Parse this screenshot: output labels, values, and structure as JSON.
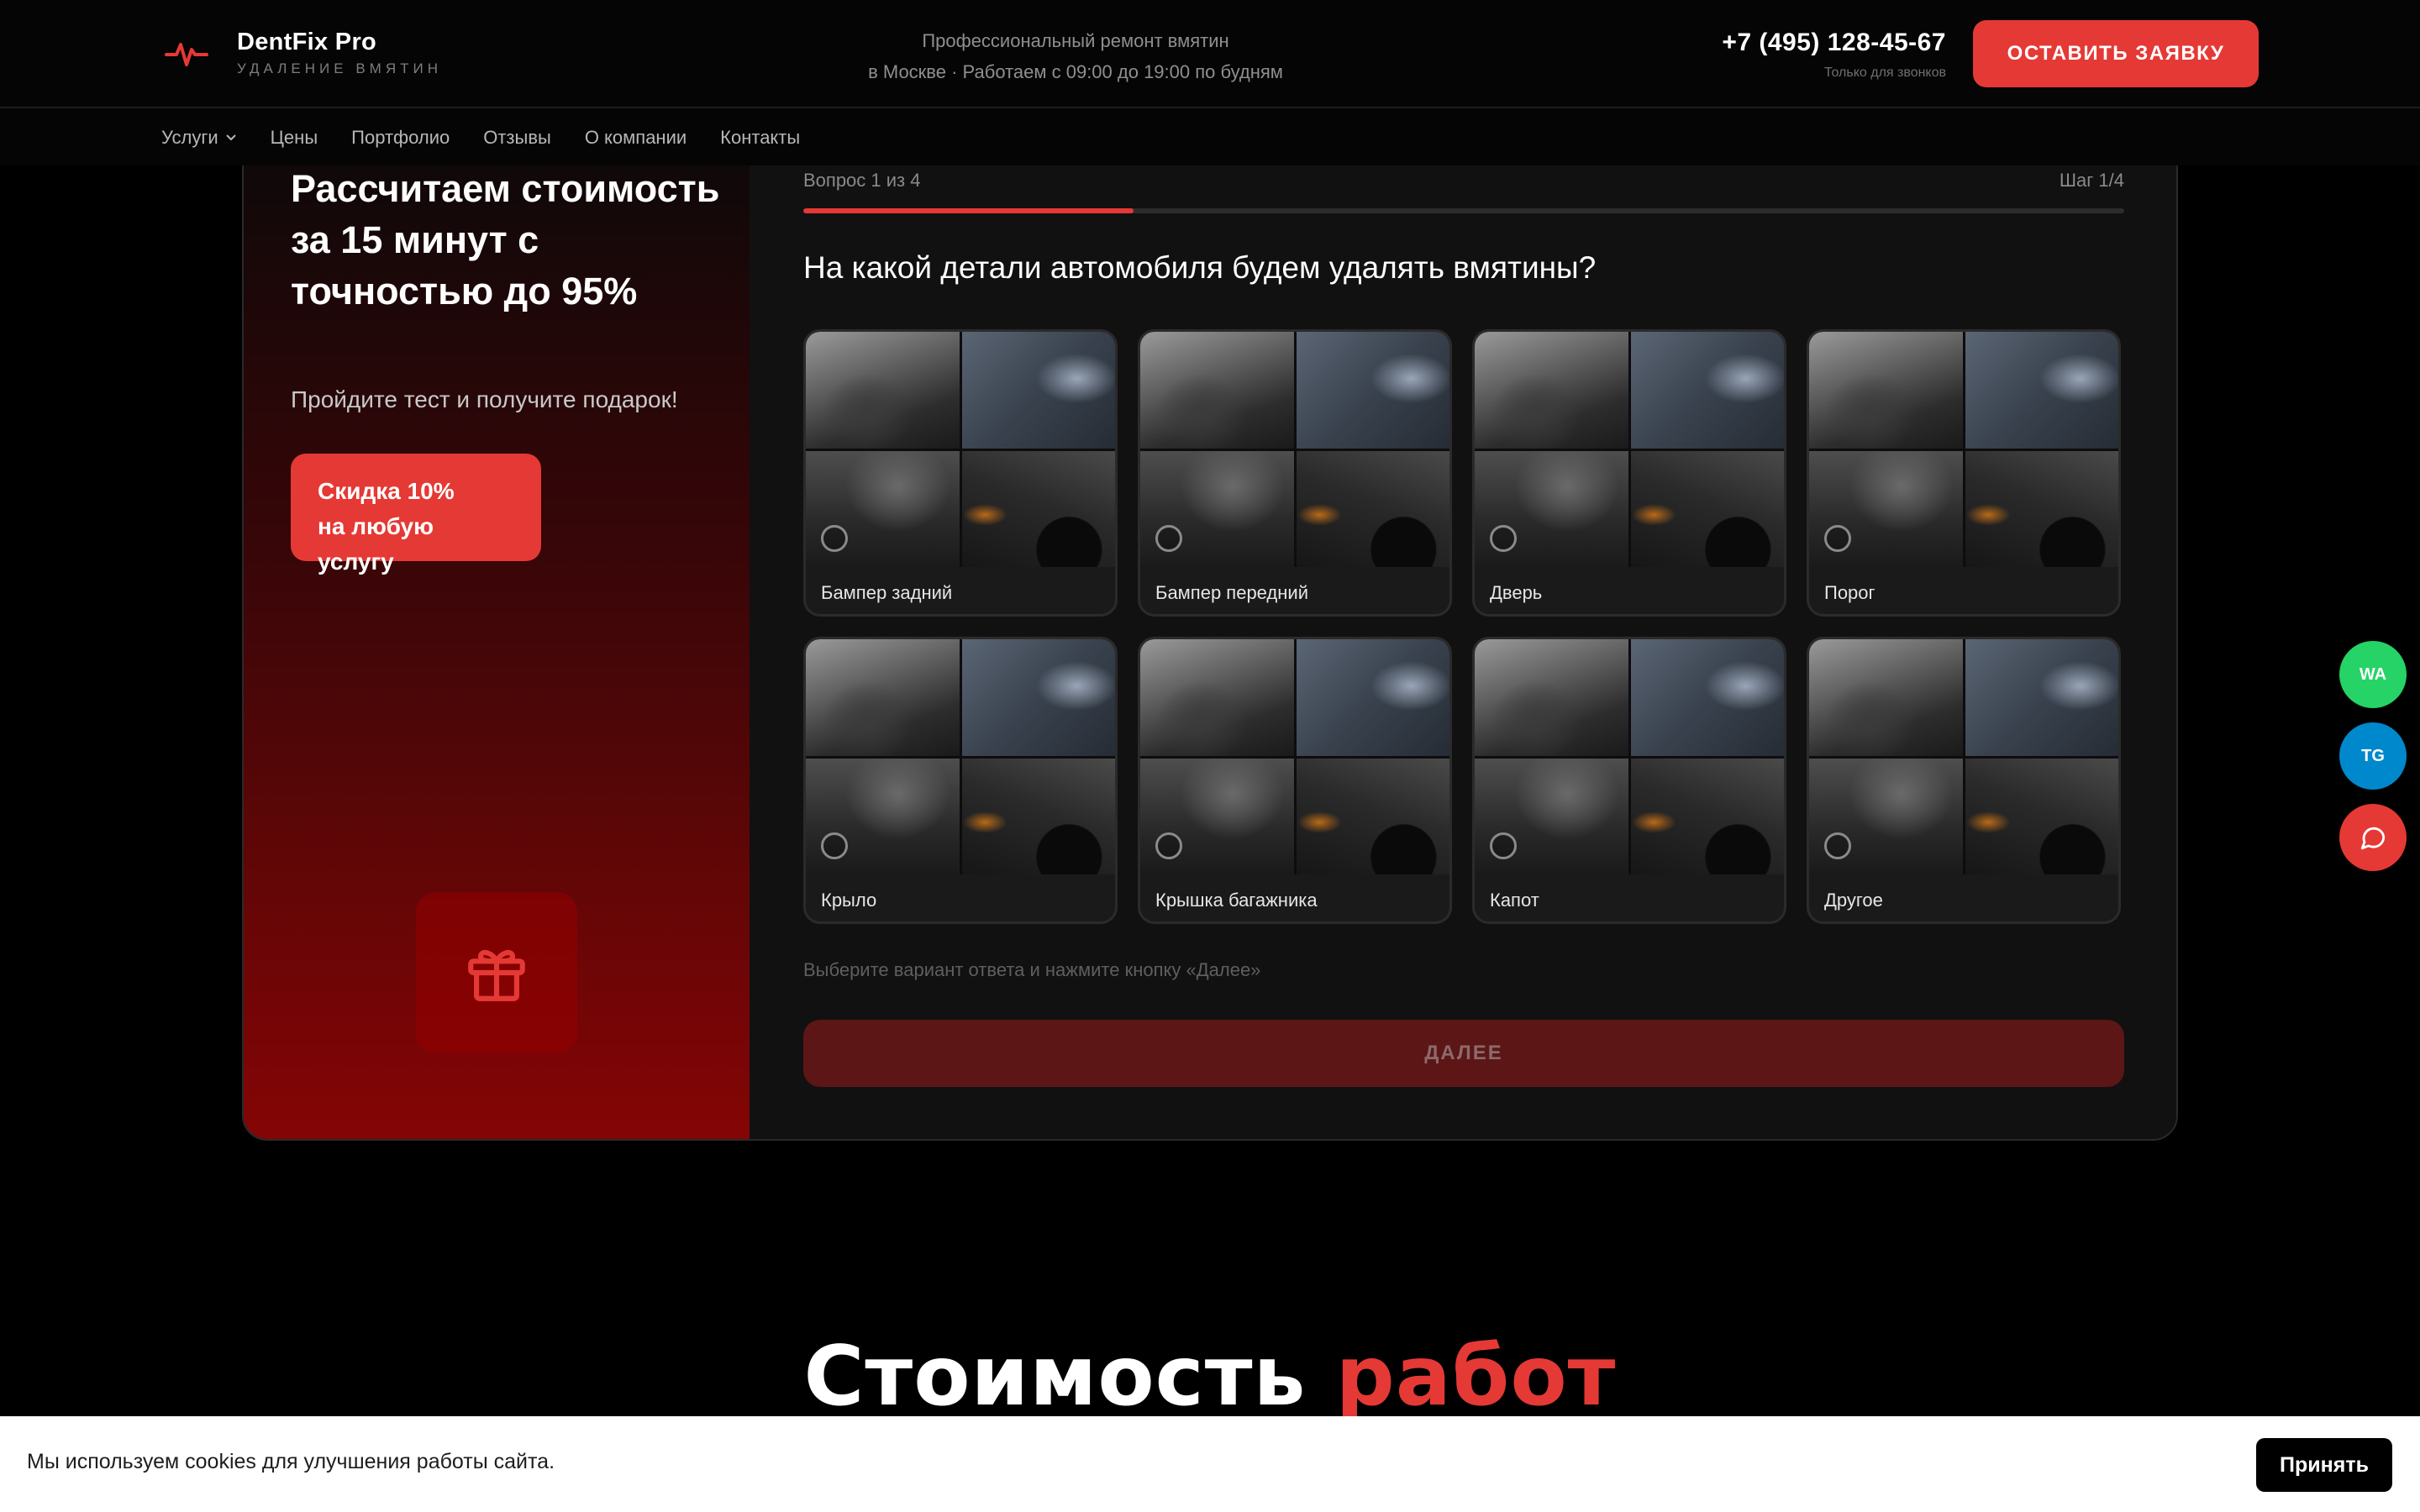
{
  "header": {
    "brand": "DentFix Pro",
    "brand_sub": "УДАЛЕНИЕ ВМЯТИН",
    "info_line1": "Профессиональный ремонт вмятин",
    "info_line2": "в Москве · Работаем с 09:00 до 19:00 по будням",
    "phone": "+7 (495) 128-45-67",
    "phone_note": "Только для звонков",
    "cta_label": "ОСТАВИТЬ ЗАЯВКУ"
  },
  "nav": {
    "items": [
      {
        "label": "Услуги"
      },
      {
        "label": "Цены"
      },
      {
        "label": "Портфолио"
      },
      {
        "label": "Отзывы"
      },
      {
        "label": "О компании"
      },
      {
        "label": "Контакты"
      }
    ]
  },
  "quiz": {
    "title": "Рассчитаем стоимость за 15 минут с точностью до 95%",
    "subtitle": "Пройдите тест и получите подарок!",
    "discount_line1": "Скидка 10%",
    "discount_line2": "на любую услугу",
    "counter": "Вопрос 1 из 4",
    "step": "Шаг 1/4",
    "progress_fraction": 0.25,
    "question": "На какой детали автомобиля будем удалять вмятины?",
    "options": [
      {
        "label": "Бампер задний"
      },
      {
        "label": "Бампер передний"
      },
      {
        "label": "Дверь"
      },
      {
        "label": "Порог"
      },
      {
        "label": "Крыло"
      },
      {
        "label": "Крышка багажника"
      },
      {
        "label": "Капот"
      },
      {
        "label": "Другое"
      }
    ],
    "hint": "Выберите вариант ответа и нажмите кнопку «Далее»",
    "next_label": "ДАЛЕЕ"
  },
  "section": {
    "title_word1": "Стоимость",
    "title_word2": "работ"
  },
  "floating": {
    "wa_label": "WA",
    "tg_label": "TG"
  },
  "cookie": {
    "text": "Мы используем cookies для улучшения работы сайта.",
    "accept_label": "Принять"
  },
  "colors": {
    "accent": "#e53935",
    "whatsapp": "#25d366",
    "telegram": "#0088cc"
  },
  "icons": {
    "logo": "pulse-icon",
    "gift": "gift-icon",
    "chat": "chat-bubble-icon",
    "chevron": "chevron-down-icon"
  }
}
